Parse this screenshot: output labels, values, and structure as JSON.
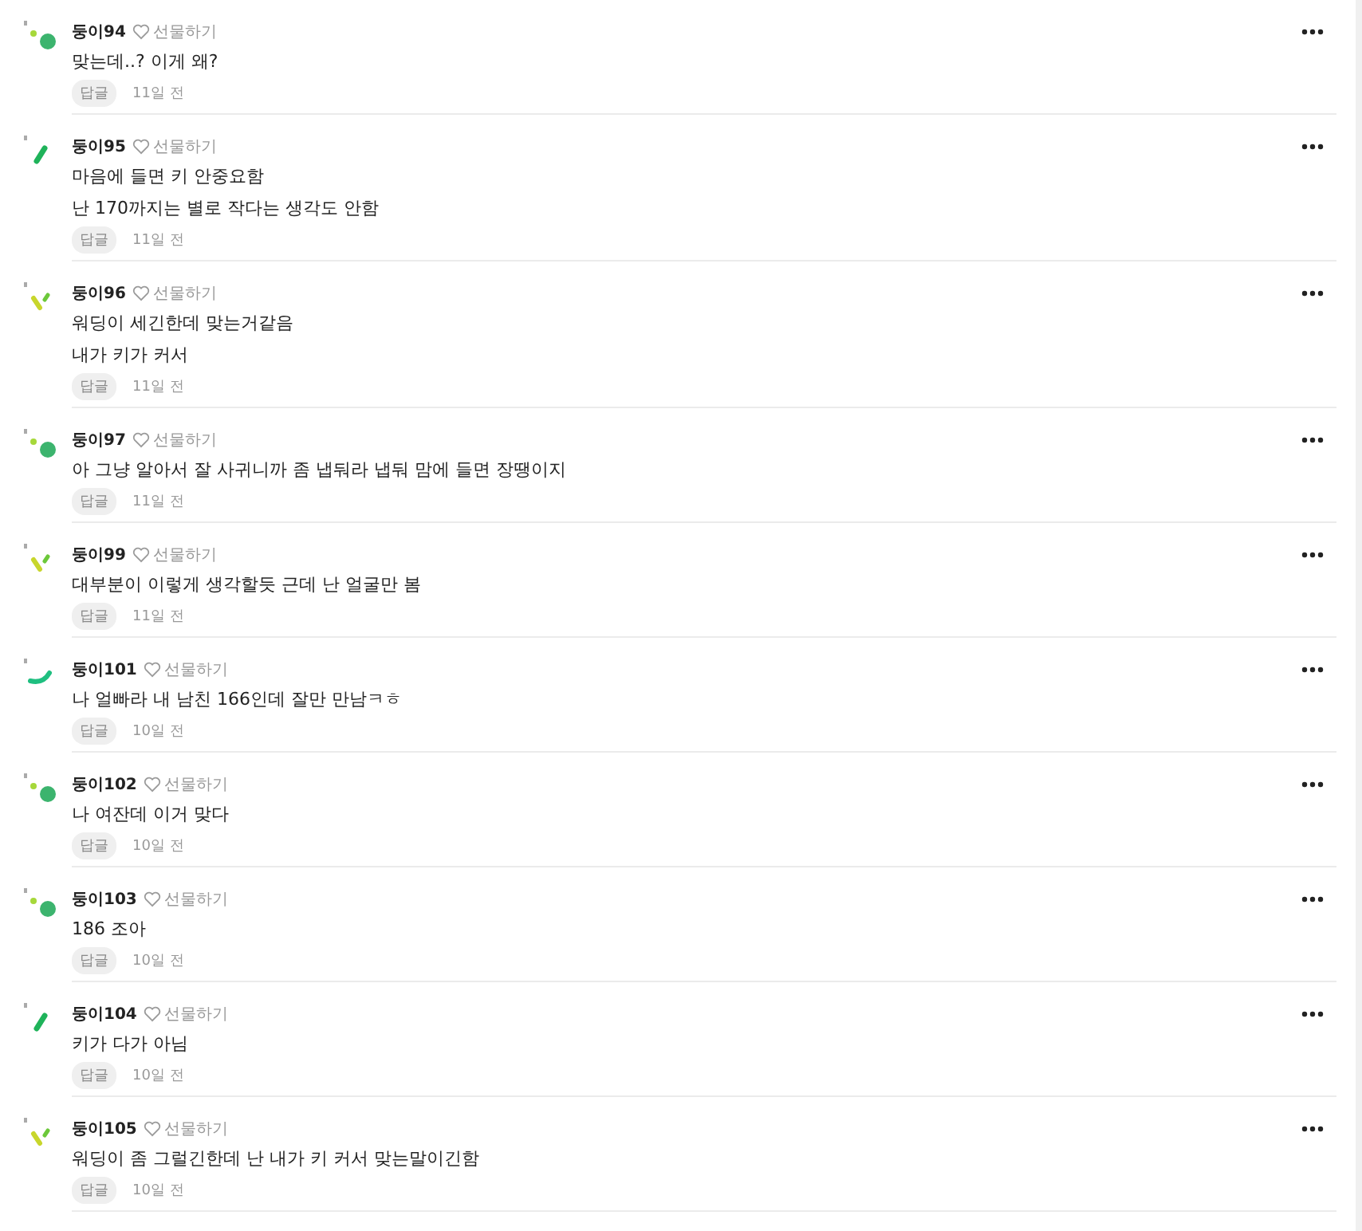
{
  "comments": [
    {
      "kind": "dots",
      "name": "둥이94",
      "gift": "선물하기",
      "lines": [
        "맞는데..? 이게 왜?"
      ],
      "reply": "답글",
      "time": "11일 전"
    },
    {
      "kind": "bar",
      "name": "둥이95",
      "gift": "선물하기",
      "lines": [
        "마음에 들면 키 안중요함",
        "난 170까지는 별로 작다는 생각도 안함"
      ],
      "reply": "답글",
      "time": "11일 전"
    },
    {
      "kind": "tick",
      "name": "둥이96",
      "gift": "선물하기",
      "lines": [
        "워딩이 세긴한데 맞는거같음",
        "내가 키가 커서"
      ],
      "reply": "답글",
      "time": "11일 전"
    },
    {
      "kind": "dots",
      "name": "둥이97",
      "gift": "선물하기",
      "lines": [
        "아 그냥 알아서 잘 사귀니까 좀 냅둬라 냅둬 맘에 들면 장땡이지"
      ],
      "reply": "답글",
      "time": "11일 전"
    },
    {
      "kind": "tick",
      "name": "둥이99",
      "gift": "선물하기",
      "lines": [
        "대부분이 이렇게 생각할듯 근데 난 얼굴만 봄"
      ],
      "reply": "답글",
      "time": "11일 전"
    },
    {
      "kind": "arc",
      "name": "둥이101",
      "gift": "선물하기",
      "lines": [
        "나 얼빠라 내 남친 166인데 잘만 만남ㅋㅎ"
      ],
      "reply": "답글",
      "time": "10일 전"
    },
    {
      "kind": "dots",
      "name": "둥이102",
      "gift": "선물하기",
      "lines": [
        "나 여잔데 이거 맞다"
      ],
      "reply": "답글",
      "time": "10일 전"
    },
    {
      "kind": "dots",
      "name": "둥이103",
      "gift": "선물하기",
      "lines": [
        "186 조아"
      ],
      "reply": "답글",
      "time": "10일 전"
    },
    {
      "kind": "bar",
      "name": "둥이104",
      "gift": "선물하기",
      "lines": [
        "키가 다가 아님"
      ],
      "reply": "답글",
      "time": "10일 전"
    },
    {
      "kind": "tick",
      "name": "둥이105",
      "gift": "선물하기",
      "lines": [
        "워딩이 좀 그럴긴한데 난 내가 키 커서 맞는말이긴함"
      ],
      "reply": "답글",
      "time": "10일 전"
    }
  ]
}
